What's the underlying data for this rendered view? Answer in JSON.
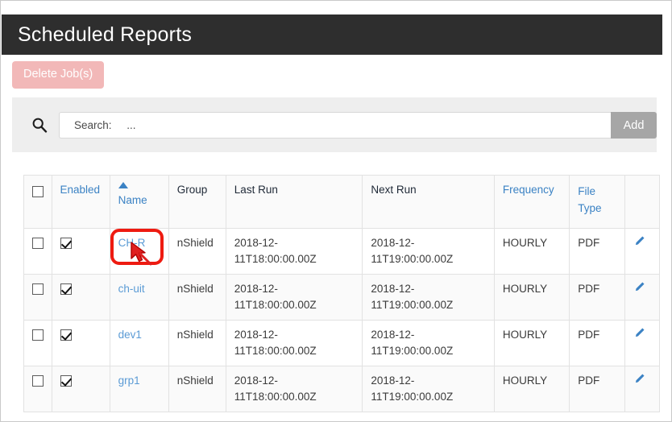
{
  "window": {
    "title": "Scheduled Reports"
  },
  "toolbar": {
    "delete_label": "Delete Job(s)"
  },
  "search": {
    "icon": "search-icon",
    "placeholder": "Search:     ...",
    "value": "",
    "add_label": "Add"
  },
  "table": {
    "columns": [
      {
        "key": "select",
        "label": "",
        "sortable": false,
        "link": false
      },
      {
        "key": "enabled",
        "label": "Enabled",
        "sortable": true,
        "link": true
      },
      {
        "key": "name",
        "label": "Name",
        "sortable": true,
        "link": true,
        "sorted": "asc"
      },
      {
        "key": "group",
        "label": "Group",
        "sortable": false,
        "link": false
      },
      {
        "key": "last_run",
        "label": "Last Run",
        "sortable": false,
        "link": false
      },
      {
        "key": "next_run",
        "label": "Next Run",
        "sortable": false,
        "link": false
      },
      {
        "key": "frequency",
        "label": "Frequency",
        "sortable": true,
        "link": true
      },
      {
        "key": "file_type",
        "label": "File Type",
        "sortable": true,
        "link": true
      },
      {
        "key": "edit",
        "label": "",
        "sortable": false,
        "link": false
      }
    ],
    "header_file_type_line1": "File",
    "header_file_type_line2": "Type",
    "rows": [
      {
        "selected": false,
        "enabled": true,
        "name": "CH-R",
        "group": "nShield",
        "last_run": "2018-12-11T18:00:00.00Z",
        "next_run": "2018-12-11T19:00:00.00Z",
        "frequency": "HOURLY",
        "file_type": "PDF",
        "edit_icon": "pencil-icon"
      },
      {
        "selected": false,
        "enabled": true,
        "name": "ch-uit",
        "group": "nShield",
        "last_run": "2018-12-11T18:00:00.00Z",
        "next_run": "2018-12-11T19:00:00.00Z",
        "frequency": "HOURLY",
        "file_type": "PDF",
        "edit_icon": "pencil-icon"
      },
      {
        "selected": false,
        "enabled": true,
        "name": "dev1",
        "group": "nShield",
        "last_run": "2018-12-11T18:00:00.00Z",
        "next_run": "2018-12-11T19:00:00.00Z",
        "frequency": "HOURLY",
        "file_type": "PDF",
        "edit_icon": "pencil-icon"
      },
      {
        "selected": false,
        "enabled": true,
        "name": "grp1",
        "group": "nShield",
        "last_run": "2018-12-11T18:00:00.00Z",
        "next_run": "2018-12-11T19:00:00.00Z",
        "frequency": "HOURLY",
        "file_type": "PDF",
        "edit_icon": "pencil-icon"
      }
    ]
  },
  "annotation": {
    "highlight_target": "CH-R",
    "highlight_color": "#ee1b11",
    "cursor_color": "#e02020"
  },
  "colors": {
    "titlebar_bg": "#2e2e2e",
    "link_blue": "#3b82c4",
    "name_link_blue": "#5b9bd5",
    "delete_btn_bg": "#f2b8b8",
    "add_btn_bg": "#a6a6a6",
    "panel_bg": "#eeeeee",
    "row_alt_bg": "#fafafa"
  }
}
